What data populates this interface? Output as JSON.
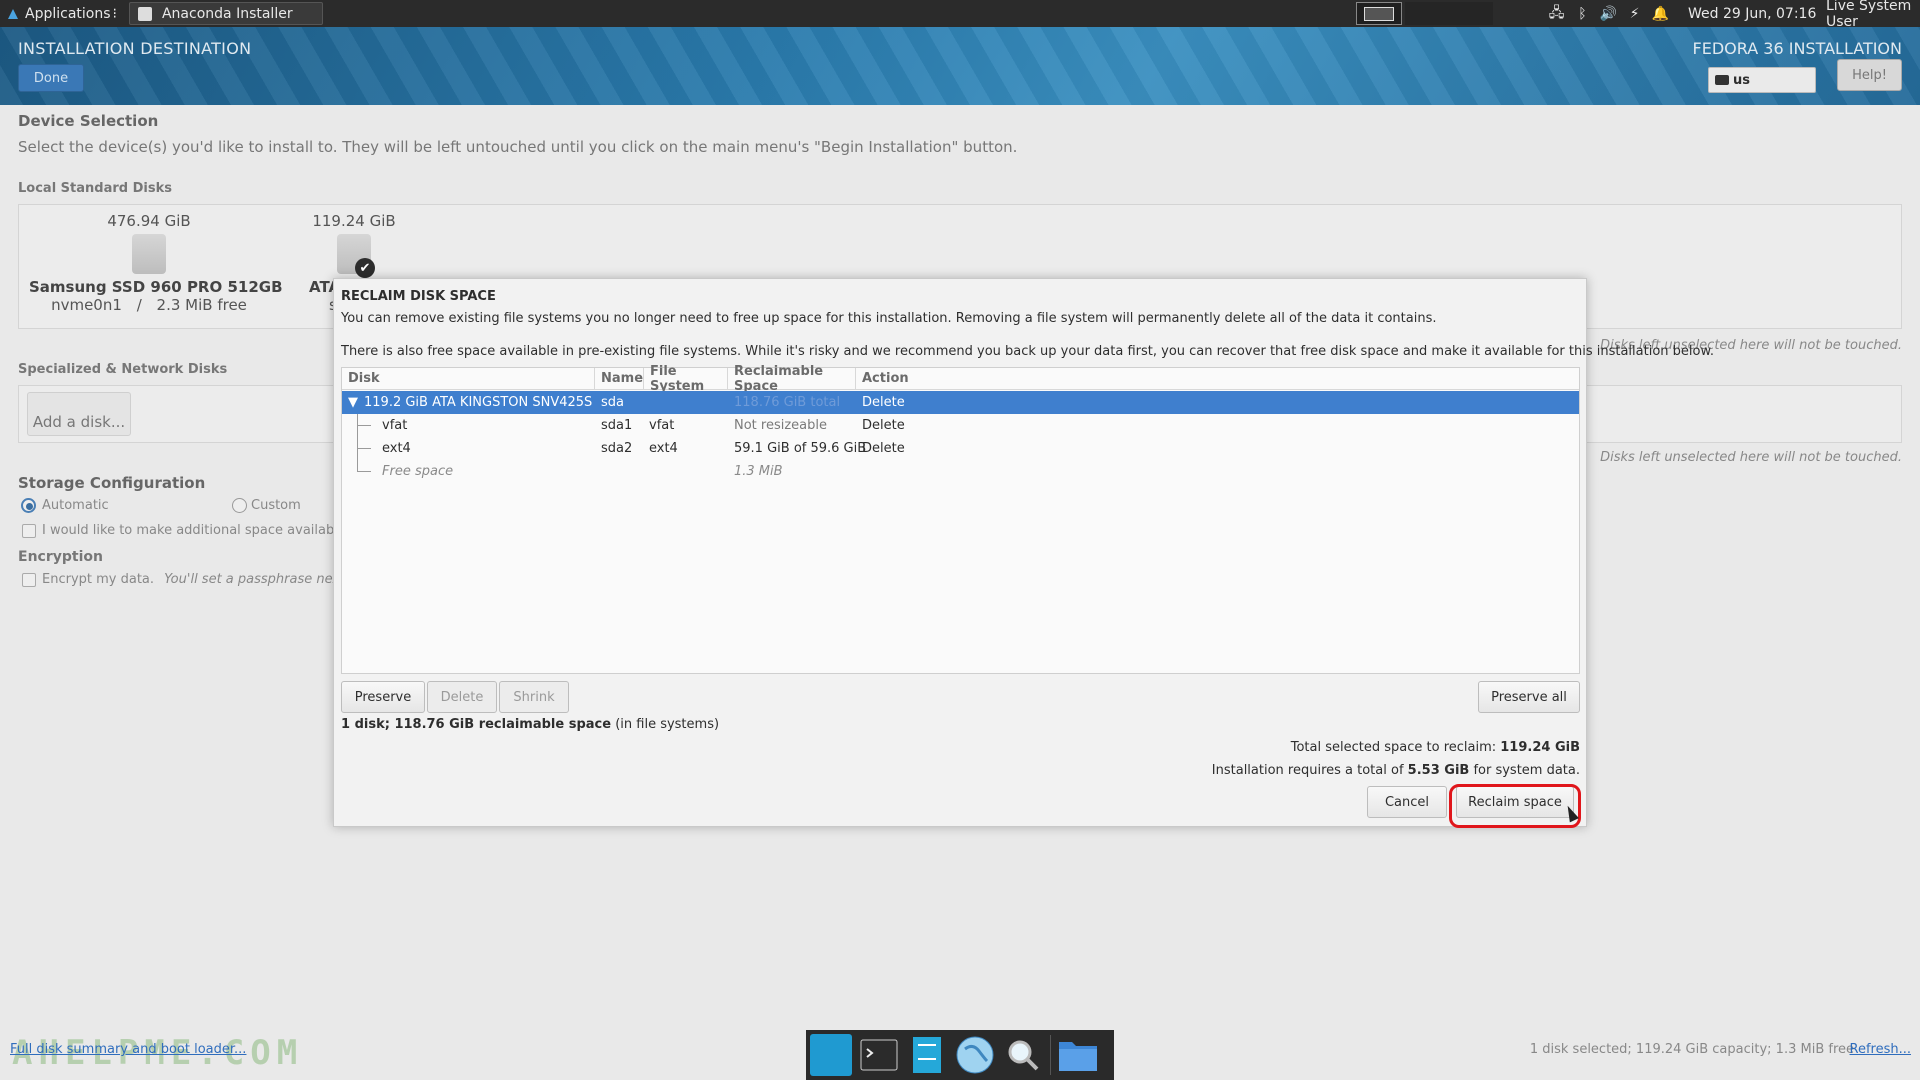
{
  "system_panel": {
    "applications_label": "Applications",
    "task_label": "Anaconda Installer",
    "clock": "Wed 29 Jun, 07:16",
    "user": "Live System User"
  },
  "header": {
    "title": "INSTALLATION DESTINATION",
    "done_label": "Done",
    "product": "FEDORA 36 INSTALLATION",
    "keyboard_layout": "us",
    "help_label": "Help!"
  },
  "page": {
    "device_selection_title": "Device Selection",
    "device_selection_desc": "Select the device(s) you'd like to install to.  They will be left untouched until you click on the main menu's \"Begin Installation\" button.",
    "local_disks_title": "Local Standard Disks",
    "disks": [
      {
        "size": "476.94 GiB",
        "name": "Samsung SSD 960 PRO 512GB",
        "device": "nvme0n1",
        "separator": "/",
        "free": "2.3 MiB free"
      },
      {
        "size": "119.24 GiB",
        "name": "ATA K",
        "device": "sda"
      }
    ],
    "unselected_note": "Disks left unselected here will not be touched.",
    "specialized_title": "Specialized & Network Disks",
    "add_disk_label": "Add a disk...",
    "storage_config_title": "Storage Configuration",
    "automatic_label": "Automatic",
    "custom_label": "Custom",
    "additional_space_label": "I would like to make additional space available.",
    "encryption_title": "Encryption",
    "encrypt_label": "Encrypt my data.",
    "encrypt_hint": "You'll set a passphrase next.",
    "footer_link": "Full disk summary and boot loader...",
    "footer_status": "1 disk selected; 119.24 GiB capacity; 1.3 MiB free",
    "refresh_label": "Refresh...",
    "watermark": "AHELPME.COM"
  },
  "dialog": {
    "title": "RECLAIM DISK SPACE",
    "text1": "You can remove existing file systems you no longer need to free up space for this installation.  Removing a file system will permanently delete all of the data it contains.",
    "text2": "There is also free space available in pre-existing file systems.  While it's risky and we recommend you back up your data first, you can recover that free disk space and make it available for this installation below.",
    "columns": [
      "Disk",
      "Name",
      "File System",
      "Reclaimable Space",
      "Action"
    ],
    "rows": [
      {
        "disk": "119.2 GiB ATA KINGSTON SNV425S",
        "name": "sda",
        "fs": "",
        "reclaim": "118.76 GiB total",
        "action": "Delete"
      },
      {
        "disk": "vfat",
        "name": "sda1",
        "fs": "vfat",
        "reclaim": "Not resizeable",
        "action": "Delete"
      },
      {
        "disk": "ext4",
        "name": "sda2",
        "fs": "ext4",
        "reclaim": "59.1 GiB of 59.6 GiB",
        "action": "Delete"
      },
      {
        "disk": "Free space",
        "name": "",
        "fs": "",
        "reclaim": "1.3 MiB",
        "action": ""
      }
    ],
    "preserve_label": "Preserve",
    "delete_label": "Delete",
    "shrink_label": "Shrink",
    "preserve_all_label": "Preserve all",
    "summary_bold": "1 disk; 118.76 GiB reclaimable space",
    "summary_rest": " (in file systems)",
    "total_prefix": "Total selected space to reclaim: ",
    "total_value": "119.24 GiB",
    "requires_prefix": "Installation requires a total of ",
    "requires_value": "5.53 GiB",
    "requires_suffix": " for system data.",
    "cancel_label": "Cancel",
    "reclaim_label": "Reclaim space"
  },
  "colors": {
    "accent": "#3f7fce",
    "highlight_ring": "#e0161b",
    "header_blue": "#2a7bad"
  }
}
